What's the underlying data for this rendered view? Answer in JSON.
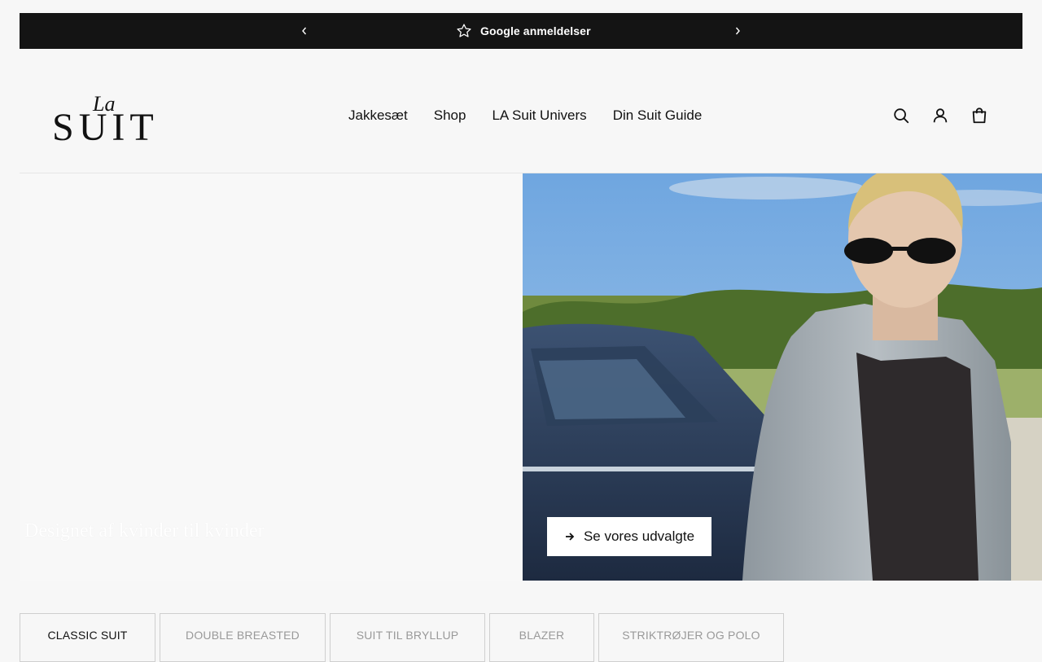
{
  "announcement": {
    "text": "Google anmeldelser",
    "icon": "star-outline-icon"
  },
  "brand": {
    "logo_script": "La",
    "logo_main": "SUIT"
  },
  "nav": {
    "items": [
      {
        "label": "Jakkesæt"
      },
      {
        "label": "Shop"
      },
      {
        "label": "LA Suit Univers"
      },
      {
        "label": "Din Suit Guide"
      }
    ]
  },
  "header_icons": [
    "search-icon",
    "account-icon",
    "cart-icon"
  ],
  "hero": {
    "tagline": "Designet af kvinder til kvinder",
    "cta_label": "Se vores udvalgte"
  },
  "tabs": [
    {
      "label": "CLASSIC SUIT",
      "active": true
    },
    {
      "label": "DOUBLE BREASTED",
      "active": false
    },
    {
      "label": "SUIT TIL BRYLLUP",
      "active": false
    },
    {
      "label": "BLAZER",
      "active": false
    },
    {
      "label": "STRIKTRØJER OG POLO",
      "active": false
    }
  ],
  "colors": {
    "bar_bg": "#141414",
    "page_bg": "#f7f7f7",
    "text": "#111111",
    "tab_inactive": "#999999"
  }
}
